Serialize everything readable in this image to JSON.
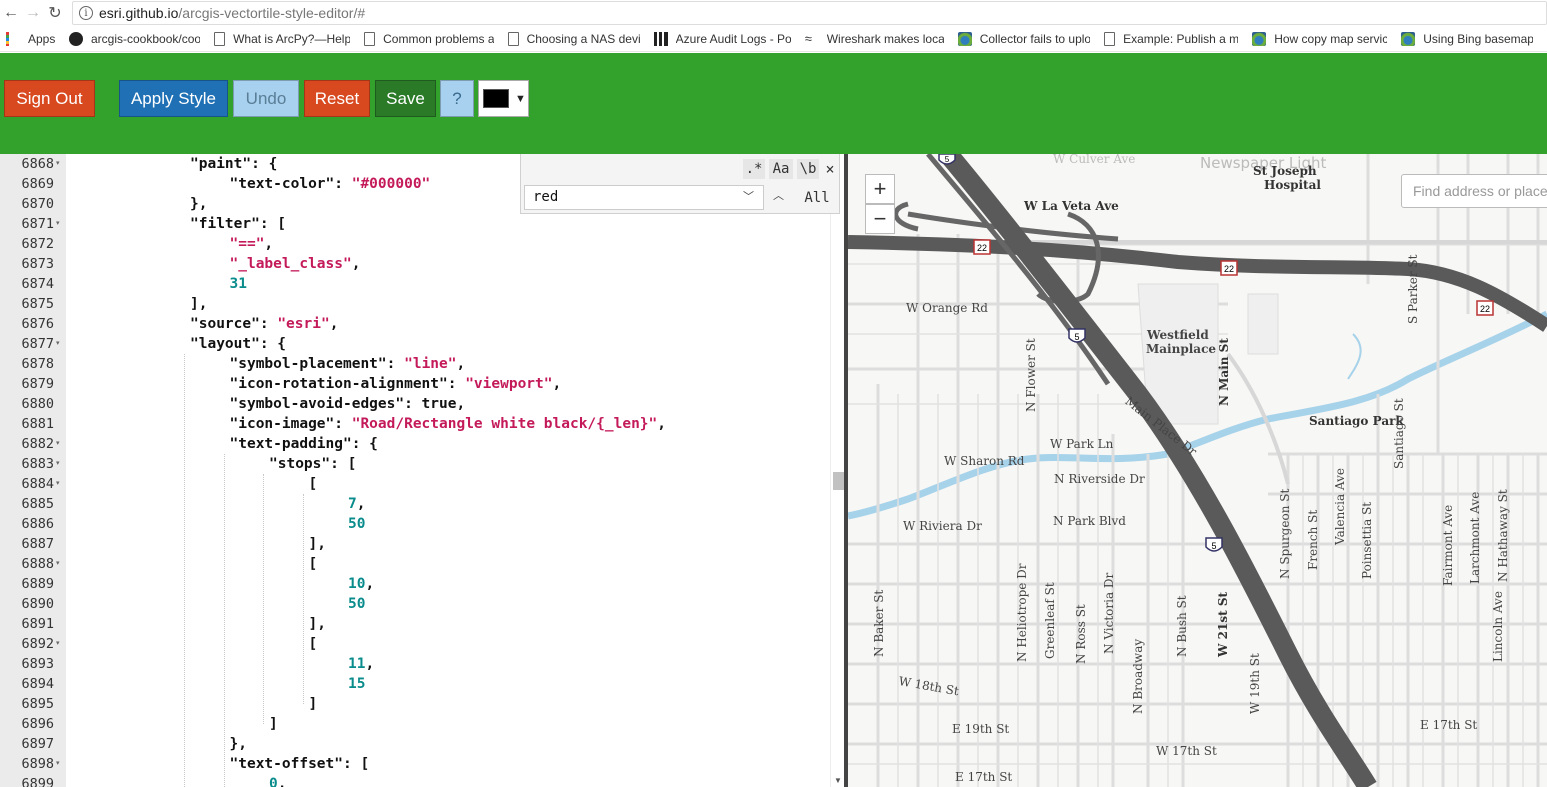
{
  "browser": {
    "url_host": "esri.github.io",
    "url_path": "/arcgis-vectortile-style-editor/#",
    "bookmarks": [
      {
        "label": "Apps",
        "icon": "apps-grid-icon"
      },
      {
        "label": "arcgis-cookbook/coo",
        "icon": "github-icon"
      },
      {
        "label": "What is ArcPy?—Help",
        "icon": "doc-icon"
      },
      {
        "label": "Common problems a",
        "icon": "doc-icon"
      },
      {
        "label": "Choosing a NAS devi",
        "icon": "doc-icon"
      },
      {
        "label": "Azure Audit Logs - Po",
        "icon": "bar-chart-icon"
      },
      {
        "label": "Wireshark makes loca",
        "icon": "shark-icon"
      },
      {
        "label": "Collector fails to uplo",
        "icon": "esri-globe-icon"
      },
      {
        "label": "Example: Publish a m",
        "icon": "doc-icon"
      },
      {
        "label": "How copy map servic",
        "icon": "esri-globe-icon"
      },
      {
        "label": "Using Bing basemap",
        "icon": "esri-globe-icon"
      }
    ]
  },
  "toolbar": {
    "sign_out": "Sign Out",
    "apply_style": "Apply Style",
    "undo": "Undo",
    "reset": "Reset",
    "save": "Save",
    "help": "?",
    "color_value": "#000000",
    "accent_color": "#33a22d"
  },
  "editor": {
    "lines": [
      {
        "n": "6868",
        "fold": true,
        "indent": 3,
        "html": "<span>\"paint\": {</span>"
      },
      {
        "n": "6869",
        "fold": false,
        "indent": 4,
        "html": "\"text-color\": <span class='s'>\"#000000\"</span>"
      },
      {
        "n": "6870",
        "fold": false,
        "indent": 3,
        "html": "},"
      },
      {
        "n": "6871",
        "fold": true,
        "indent": 3,
        "html": "\"filter\": ["
      },
      {
        "n": "6872",
        "fold": false,
        "indent": 4,
        "html": "<span class='s'>\"==\"</span>,"
      },
      {
        "n": "6873",
        "fold": false,
        "indent": 4,
        "html": "<span class='s'>\"_label_class\"</span>,"
      },
      {
        "n": "6874",
        "fold": false,
        "indent": 4,
        "html": "<span class='n'>31</span>"
      },
      {
        "n": "6875",
        "fold": false,
        "indent": 3,
        "html": "],"
      },
      {
        "n": "6876",
        "fold": false,
        "indent": 3,
        "html": "\"source\": <span class='s'>\"esri\"</span>,"
      },
      {
        "n": "6877",
        "fold": true,
        "indent": 3,
        "html": "\"layout\": {"
      },
      {
        "n": "6878",
        "fold": false,
        "indent": 4,
        "html": "\"symbol-placement\": <span class='s'>\"line\"</span>,"
      },
      {
        "n": "6879",
        "fold": false,
        "indent": 4,
        "html": "\"icon-rotation-alignment\": <span class='s'>\"viewport\"</span>,"
      },
      {
        "n": "6880",
        "fold": false,
        "indent": 4,
        "html": "\"symbol-avoid-edges\": true,"
      },
      {
        "n": "6881",
        "fold": false,
        "indent": 4,
        "html": "\"icon-image\": <span class='s'>\"Road/Rectangle white black/{_len}\"</span>,"
      },
      {
        "n": "6882",
        "fold": true,
        "indent": 4,
        "html": "\"text-padding\": {"
      },
      {
        "n": "6883",
        "fold": true,
        "indent": 5,
        "html": "\"stops\": ["
      },
      {
        "n": "6884",
        "fold": true,
        "indent": 6,
        "html": "["
      },
      {
        "n": "6885",
        "fold": false,
        "indent": 7,
        "html": "<span class='n'>7</span>,"
      },
      {
        "n": "6886",
        "fold": false,
        "indent": 7,
        "html": "<span class='n'>50</span>"
      },
      {
        "n": "6887",
        "fold": false,
        "indent": 6,
        "html": "],"
      },
      {
        "n": "6888",
        "fold": true,
        "indent": 6,
        "html": "["
      },
      {
        "n": "6889",
        "fold": false,
        "indent": 7,
        "html": "<span class='n'>10</span>,"
      },
      {
        "n": "6890",
        "fold": false,
        "indent": 7,
        "html": "<span class='n'>50</span>"
      },
      {
        "n": "6891",
        "fold": false,
        "indent": 6,
        "html": "],"
      },
      {
        "n": "6892",
        "fold": true,
        "indent": 6,
        "html": "["
      },
      {
        "n": "6893",
        "fold": false,
        "indent": 7,
        "html": "<span class='n'>11</span>,"
      },
      {
        "n": "6894",
        "fold": false,
        "indent": 7,
        "html": "<span class='n'>15</span>"
      },
      {
        "n": "6895",
        "fold": false,
        "indent": 6,
        "html": "]"
      },
      {
        "n": "6896",
        "fold": false,
        "indent": 5,
        "html": "]"
      },
      {
        "n": "6897",
        "fold": false,
        "indent": 4,
        "html": "},"
      },
      {
        "n": "6898",
        "fold": true,
        "indent": 4,
        "html": "\"text-offset\": ["
      },
      {
        "n": "6899",
        "fold": false,
        "indent": 5,
        "html": "<span class='n'>0</span>,"
      }
    ]
  },
  "search": {
    "query": "red",
    "regex": ".*",
    "case": "Aa",
    "word": "\\b",
    "close": "×",
    "all": "All"
  },
  "map": {
    "zoom_in": "+",
    "zoom_out": "−",
    "search_placeholder": "Find address or place",
    "labels": [
      "W Culver Ave",
      "Newspaper Light",
      "St Joseph",
      "Hospital",
      "W La Veta Ave",
      "W Orange Rd",
      "Westfield",
      "Mainplace",
      "N Main St",
      "Main Place Dr",
      "Santiago Park",
      "S Parker St",
      "N Flower St",
      "W Park Ln",
      "W Sharon Rd",
      "N Riverside Dr",
      "N Park Blvd",
      "W Riviera Dr",
      "Santiago St",
      "N Spurgeon St",
      "French St",
      "Valencia Ave",
      "Poinsettia St",
      "Fairmont Ave",
      "Larchmont Ave",
      "N Hathaway St",
      "Lincoln Ave",
      "N Baker St",
      "N Heliotrope Dr",
      "Greenleaf St",
      "N Ross St",
      "N Victoria Dr",
      "N Broadway",
      "N Bush St",
      "W 21st St",
      "W 19th St",
      "W 18th St",
      "E 19th St",
      "W 17th St",
      "E 17th St",
      "E 17th St"
    ],
    "shields": [
      "22",
      "22",
      "22",
      "5",
      "5",
      "5"
    ]
  }
}
